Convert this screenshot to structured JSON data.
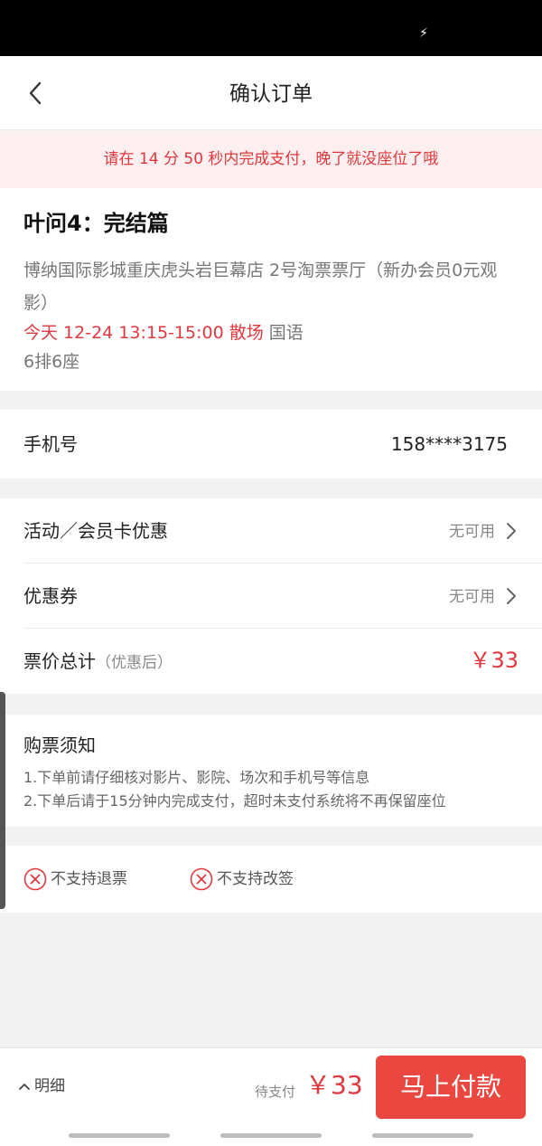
{
  "status_bar": {
    "charging_icon": "bolt-icon",
    "charging_glyph": "⚡"
  },
  "header": {
    "back_icon": "chevron-left-icon",
    "title": "确认订单"
  },
  "countdown": {
    "text": "请在 14 分 50 秒内完成支付，晚了就没座位了哦"
  },
  "movie": {
    "name": "叶问4：完结篇",
    "cinema": "博纳国际影城重庆虎头岩巨幕店 2号淘票票厅（新办会员0元观影）",
    "showtime": "今天 12-24 13:15-15:00 散场",
    "language": "国语",
    "seat": "6排6座"
  },
  "phone": {
    "label": "手机号",
    "value": "158****3175"
  },
  "discounts": {
    "member_label": "活动／会员卡优惠",
    "member_status": "无可用",
    "coupon_label": "优惠券",
    "coupon_status": "无可用",
    "total_label": "票价总计",
    "total_hint": "（优惠后）",
    "total_price": "￥33"
  },
  "notice": {
    "title": "购票须知",
    "lines": [
      "1.下单前请仔细核对影片、影院、场次和手机号等信息",
      "2.下单后请于15分钟内完成支付，超时未支付系统将不再保留座位"
    ]
  },
  "policy": {
    "items": [
      {
        "icon": "x-circle-icon",
        "label": "不支持退票"
      },
      {
        "icon": "x-circle-icon",
        "label": "不支持改签"
      }
    ]
  },
  "bottom": {
    "detail_label": "明细",
    "due_label": "待支付",
    "due_price": "￥33",
    "pay_label": "马上付款"
  },
  "colors": {
    "accent": "#e0383e",
    "pay_button": "#e9473f",
    "banner_bg": "#fdefef"
  }
}
